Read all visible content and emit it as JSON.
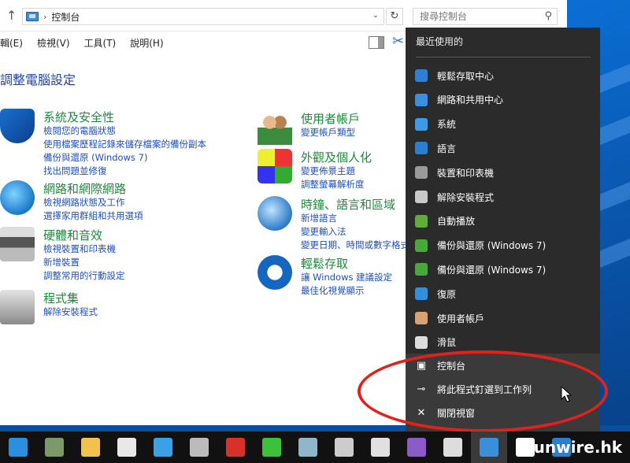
{
  "window": {
    "breadcrumb": "控制台",
    "search_placeholder": "搜尋控制台",
    "menu": [
      "編輯(E)",
      "檢視(V)",
      "工具(T)",
      "說明(H)"
    ],
    "page_title": "調整電腦設定"
  },
  "categories_left": [
    {
      "title": "系統及安全性",
      "links": [
        "檢閱您的電腦狀態",
        "使用檔案歷程記錄來儲存檔案的備份副本",
        "備份與還原 (Windows 7)",
        "找出問題並修復"
      ]
    },
    {
      "title": "網路和網際網路",
      "links": [
        "檢視網路狀態及工作",
        "選擇家用群組和共用選項"
      ]
    },
    {
      "title": "硬體和音效",
      "links": [
        "檢視裝置和印表機",
        "新增裝置",
        "調整常用的行動設定"
      ]
    },
    {
      "title": "程式集",
      "links": [
        "解除安裝程式"
      ]
    }
  ],
  "categories_right": [
    {
      "title": "使用者帳戶",
      "links": [
        "變更帳戶類型"
      ]
    },
    {
      "title": "外觀及個人化",
      "links": [
        "變更佈景主題",
        "調整螢幕解析度"
      ]
    },
    {
      "title": "時鐘、語言和區域",
      "links": [
        "新增語言",
        "變更輸入法",
        "變更日期、時間或數字格式"
      ]
    },
    {
      "title": "輕鬆存取",
      "links": [
        "讓 Windows 建議設定",
        "最佳化視覺顯示"
      ]
    }
  ],
  "jumplist": {
    "header": "最近使用的",
    "items": [
      {
        "label": "輕鬆存取中心",
        "icon": "ease-of-access-icon",
        "color": "#2f7fd8"
      },
      {
        "label": "網路和共用中心",
        "icon": "network-icon",
        "color": "#3a8fe0"
      },
      {
        "label": "系統",
        "icon": "system-icon",
        "color": "#3b9be8"
      },
      {
        "label": "語言",
        "icon": "language-icon",
        "color": "#2a7fd0"
      },
      {
        "label": "裝置和印表機",
        "icon": "printer-icon",
        "color": "#9a9a9a"
      },
      {
        "label": "解除安裝程式",
        "icon": "uninstall-icon",
        "color": "#c9c9c9"
      },
      {
        "label": "自動播放",
        "icon": "autoplay-icon",
        "color": "#5fae3c"
      },
      {
        "label": "備份與還原 (Windows 7)",
        "icon": "backup-icon",
        "color": "#49a83a"
      },
      {
        "label": "備份與還原 (Windows 7)",
        "icon": "backup-icon",
        "color": "#49a83a"
      },
      {
        "label": "復原",
        "icon": "recovery-icon",
        "color": "#2f8fe0"
      },
      {
        "label": "使用者帳戶",
        "icon": "user-accounts-icon",
        "color": "#d9a070"
      },
      {
        "label": "滑鼠",
        "icon": "mouse-icon",
        "color": "#dddddd"
      }
    ],
    "actions": [
      {
        "label": "控制台",
        "glyph": "▣"
      },
      {
        "label": "將此程式釘選到工作列",
        "glyph": "⊸"
      },
      {
        "label": "關閉視窗",
        "glyph": "✕"
      }
    ]
  },
  "taskbar": {
    "apps": [
      {
        "name": "internet-explorer-icon",
        "color": "#2b8fe0"
      },
      {
        "name": "app-icon",
        "color": "#7a9a6a"
      },
      {
        "name": "file-explorer-icon",
        "color": "#f2c14e"
      },
      {
        "name": "store-icon",
        "color": "#e8e8e8"
      },
      {
        "name": "monitor-icon",
        "color": "#3aa0e8"
      },
      {
        "name": "media-icon",
        "color": "#bbbbbb"
      },
      {
        "name": "game-icon",
        "color": "#d9302a"
      },
      {
        "name": "line-icon",
        "color": "#3cc13c"
      },
      {
        "name": "notes-icon",
        "color": "#8fb7c9"
      },
      {
        "name": "pen-icon",
        "color": "#cccccc"
      },
      {
        "name": "calculator-icon",
        "color": "#e0e0e0"
      },
      {
        "name": "visual-studio-icon",
        "color": "#8b5cc9"
      },
      {
        "name": "fox-icon",
        "color": "#dddddd"
      },
      {
        "name": "control-panel-icon",
        "color": "#3b8ed8"
      },
      {
        "name": "xbox-icon",
        "color": "#ffffff"
      },
      {
        "name": "settings-icon",
        "color": "#2a7fd0"
      }
    ],
    "watermark": "unwire.hk"
  }
}
